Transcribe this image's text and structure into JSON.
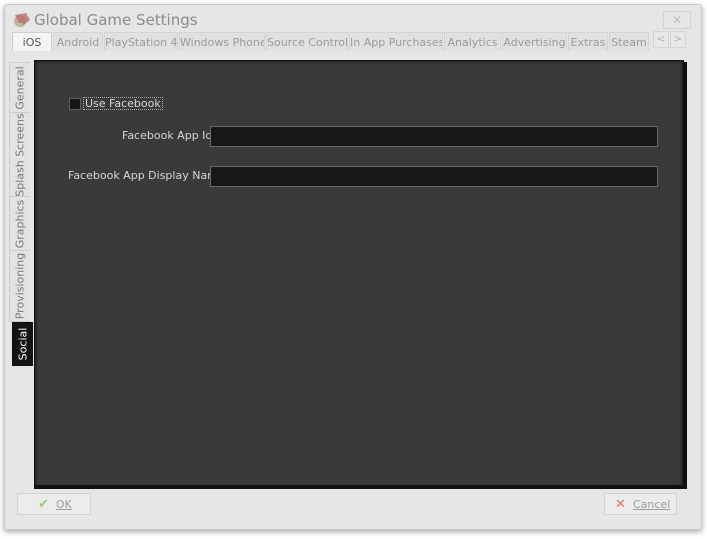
{
  "window": {
    "title": "Global Game Settings",
    "close_glyph": "✕"
  },
  "top_tabs": [
    "iOS",
    "Android",
    "PlayStation 4",
    "Windows Phone",
    "Source Control",
    "In App Purchases",
    "Analytics",
    "Advertising",
    "Extras",
    "Steam"
  ],
  "tab_scroll": {
    "left": "<",
    "right": ">"
  },
  "side_tabs": [
    "General",
    "Splash Screens",
    "Graphics",
    "Provisioning",
    "Social"
  ],
  "social": {
    "use_facebook_label": "Use Facebook",
    "use_facebook_checked": false,
    "app_id_label": "Facebook App Id",
    "app_id_value": "",
    "display_name_label": "Facebook App Display Name",
    "display_name_value": ""
  },
  "buttons": {
    "ok": "OK",
    "cancel": "Cancel"
  },
  "colors": {
    "panel_bg": "#3a3a3a",
    "active_side_tab": "#141414",
    "ok_icon": "#8bc34a",
    "cancel_icon": "#d9534f"
  },
  "icons": {
    "app": "game-maker-icon",
    "ok": "checkmark-icon",
    "cancel": "x-icon"
  }
}
